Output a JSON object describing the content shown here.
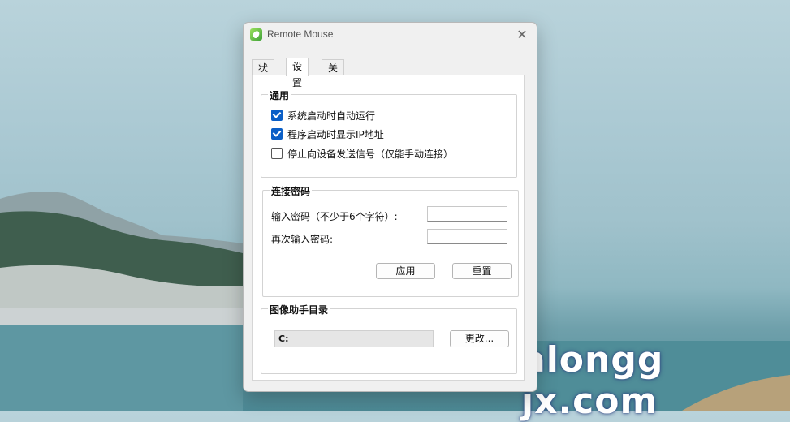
{
  "window": {
    "title": "Remote Mouse",
    "close_glyph": "✕"
  },
  "tabs": [
    {
      "label": "状态",
      "active": false
    },
    {
      "label": "设置",
      "active": true
    },
    {
      "label": "关于",
      "active": false
    }
  ],
  "general": {
    "title": "通用",
    "options": [
      {
        "label": "系统启动时自动运行",
        "checked": true
      },
      {
        "label": "程序启动时显示IP地址",
        "checked": true
      },
      {
        "label": "停止向设备发送信号（仅能手动连接）",
        "checked": false
      }
    ]
  },
  "password": {
    "title": "连接密码",
    "enter_label": "输入密码（不少于6个字符）:",
    "enter_value": "",
    "confirm_label": "再次输入密码:",
    "confirm_value": "",
    "apply_label": "应用",
    "reset_label": "重置"
  },
  "image_dir": {
    "title": "图像助手目录",
    "path": "C:",
    "change_label": "更改..."
  },
  "watermark": "alongg jx.com",
  "colors": {
    "accent": "#0a5fc7",
    "window_bg": "#f0f0f0",
    "panel_bg": "#ffffff"
  }
}
